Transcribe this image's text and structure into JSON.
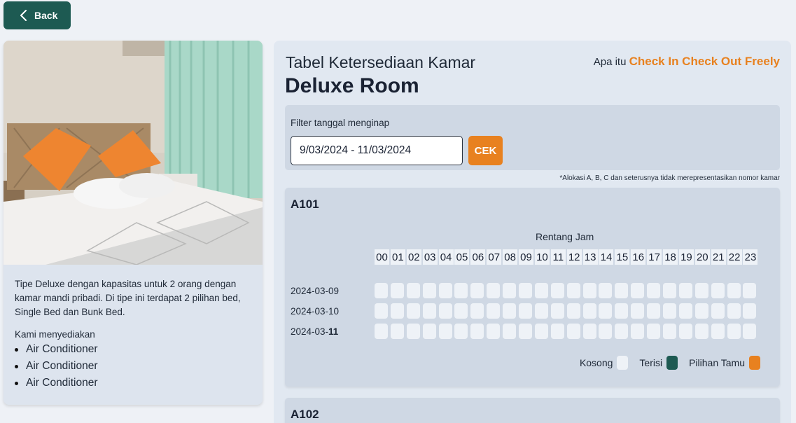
{
  "back_button": {
    "label": "Back"
  },
  "room": {
    "description": "Tipe Deluxe dengan kapasitas untuk 2 orang dengan kamar mandi pribadi. Di tipe ini terdapat 2 pilihan bed, Single Bed dan Bunk Bed.",
    "provide_heading": "Kami menyediakan",
    "amenities": [
      "Air Conditioner",
      "Air Conditioner",
      "Air Conditioner"
    ]
  },
  "availability": {
    "table_title": "Tabel Ketersediaan Kamar",
    "room_type": "Deluxe Room",
    "info_prefix": "Apa itu",
    "info_link": "Check In Check Out Freely",
    "filter_label": "Filter tanggal menginap",
    "date_range": "9/03/2024 - 11/03/2024",
    "check_button": "CEK",
    "note": "*Alokasi A, B, C dan seterusnya tidak merepresentasikan nomor kamar"
  },
  "rooms": [
    {
      "name": "A101",
      "range_label": "Rentang Jam",
      "hours": [
        "00",
        "01",
        "02",
        "03",
        "04",
        "05",
        "06",
        "07",
        "08",
        "09",
        "10",
        "11",
        "12",
        "13",
        "14",
        "15",
        "16",
        "17",
        "18",
        "19",
        "20",
        "21",
        "22",
        "23"
      ],
      "days": [
        {
          "date_prefix": "2024-03-",
          "date_day": "09"
        },
        {
          "date_prefix": "2024-03-",
          "date_day": "10"
        },
        {
          "date_prefix": "2024-03-",
          "date_day": "11"
        }
      ],
      "legend": [
        {
          "label": "Kosong",
          "color": "#eef2f7"
        },
        {
          "label": "Terisi",
          "color": "#1d5a52"
        },
        {
          "label": "Pilihan Tamu",
          "color": "#e8811f"
        }
      ]
    },
    {
      "name": "A102"
    }
  ],
  "colors": {
    "primary": "#1d5a52",
    "accent": "#e8811f",
    "empty_slot": "#eef2f7"
  }
}
